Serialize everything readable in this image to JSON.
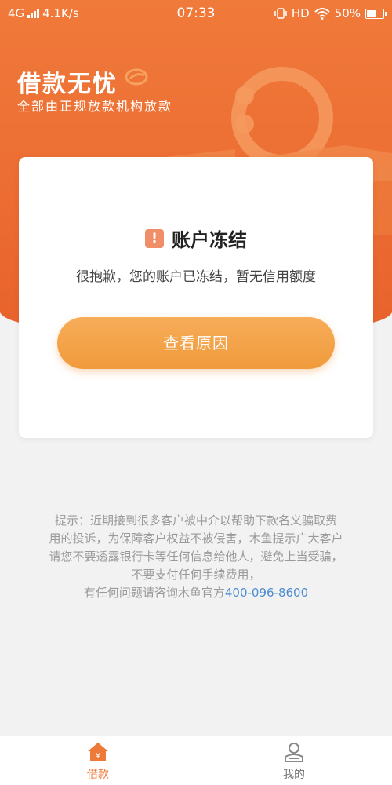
{
  "status_bar": {
    "network": "4G",
    "speed": "4.1K/s",
    "time": "07:33",
    "hd": "HD",
    "battery": "50%"
  },
  "brand": {
    "title": "借款无忧",
    "subtitle": "全部由正规放款机构放款"
  },
  "card": {
    "title": "账户冻结",
    "description": "很抱歉，您的账户已冻结，暂无信用额度",
    "button_label": "查看原因"
  },
  "notice": {
    "line1": "提示：近期接到很多客户被中介以帮助下款名义骗取费",
    "line2": "用的投诉，为保障客户权益不被侵害，木鱼提示广大客户",
    "line3": "请您不要透露银行卡等任何信息给他人，避免上当受骗，",
    "line4": "不要支付任何手续费用，",
    "line5_prefix": "有任何问题请咨询木鱼官方",
    "phone": "400-096-8600"
  },
  "bottom_nav": {
    "items": [
      {
        "label": "借款",
        "icon": "home-yen-icon",
        "active": true
      },
      {
        "label": "我的",
        "icon": "user-icon",
        "active": false
      }
    ]
  },
  "colors": {
    "brand_orange": "#ec6d33",
    "button_orange": "#f5a44c",
    "link_blue": "#4a8cd0",
    "warning": "#f08e68"
  }
}
